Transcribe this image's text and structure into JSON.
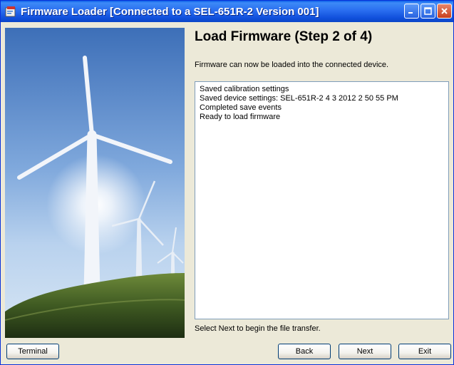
{
  "window": {
    "title": "Firmware Loader [Connected to a SEL-651R-2 Version 001]",
    "accent_color": "#2a6ef0",
    "controls": {
      "minimize_icon": "minimize-icon",
      "maximize_icon": "maximize-icon",
      "close_icon": "close-icon"
    }
  },
  "wizard": {
    "step_title": "Load Firmware (Step 2 of 4)",
    "info_text": "Firmware can now be loaded into the connected device.",
    "log_lines": [
      "Saved calibration settings",
      "Saved device settings: SEL-651R-2 4 3 2012 2 50 55 PM",
      "Completed save events",
      "Ready to load firmware"
    ],
    "hint_text": "Select Next to begin the file transfer."
  },
  "buttons": {
    "terminal": "Terminal",
    "back": "Back",
    "next": "Next",
    "exit": "Exit"
  }
}
